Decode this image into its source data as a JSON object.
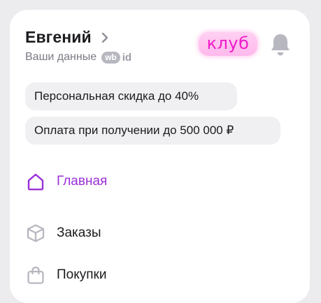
{
  "profile": {
    "name": "Евгений",
    "subtitle": "Ваши данные",
    "wb_badge": "wb",
    "id_badge": "id"
  },
  "club": {
    "label": "клуб"
  },
  "chips": [
    {
      "label": "Персональная скидка до 40%"
    },
    {
      "label": "Оплата при получении до 500 000 ₽"
    }
  ],
  "nav": {
    "items": [
      {
        "label": "Главная",
        "icon": "home-icon",
        "active": true
      },
      {
        "label": "Заказы",
        "icon": "box-icon",
        "active": false
      },
      {
        "label": "Покупки",
        "icon": "shopping-bag-icon",
        "active": false
      }
    ]
  },
  "colors": {
    "accent": "#9b2fd8",
    "club_text": "#ef1bc9",
    "club_bg": "#ffc4ee",
    "icon_gray": "#b7b7c0",
    "chip_bg": "#f0f0f3",
    "page_bg": "#ececef"
  }
}
